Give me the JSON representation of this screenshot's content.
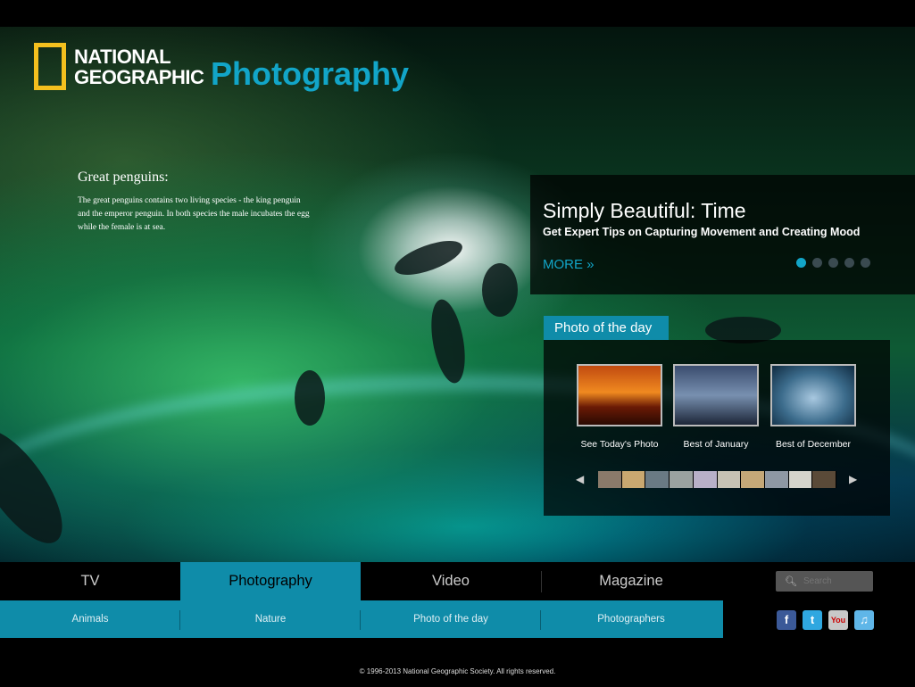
{
  "brand": {
    "logo_line1": "NATIONAL",
    "logo_line2": "GEOGRAPHIC",
    "section_title": "Photography",
    "accent_color": "#12a5c8",
    "logo_color": "#f4c01e"
  },
  "caption": {
    "title": "Great penguins:",
    "body": "The great penguins contains two living species - the king penguin and the emperor penguin. In both species the male incubates the egg while the female is at sea."
  },
  "feature": {
    "title": "Simply Beautiful: Time",
    "subtitle": "Get Expert Tips on Capturing Movement and Creating Mood",
    "more_label": "MORE »",
    "dots": 5,
    "active_dot": 1
  },
  "photo_of_day": {
    "tab_label": "Photo of the day",
    "items": [
      {
        "label": "See Today's Photo"
      },
      {
        "label": "Best of January"
      },
      {
        "label": "Best of December"
      }
    ],
    "prev_icon": "◀",
    "next_icon": "▶"
  },
  "nav": {
    "items": [
      {
        "label": "TV"
      },
      {
        "label": "Photography"
      },
      {
        "label": "Video"
      },
      {
        "label": "Magazine"
      }
    ],
    "active": "Photography"
  },
  "subnav": {
    "items": [
      {
        "label": "Animals"
      },
      {
        "label": "Nature"
      },
      {
        "label": "Photo of the day"
      },
      {
        "label": "Photographers"
      }
    ]
  },
  "search": {
    "placeholder": "Search",
    "icon": "search-icon"
  },
  "social": {
    "facebook": "f",
    "twitter": "t",
    "youtube": "You",
    "itunes": "♫"
  },
  "footer": {
    "copyright": "© 1996-2013 National Geographic Society. All rights reserved."
  }
}
